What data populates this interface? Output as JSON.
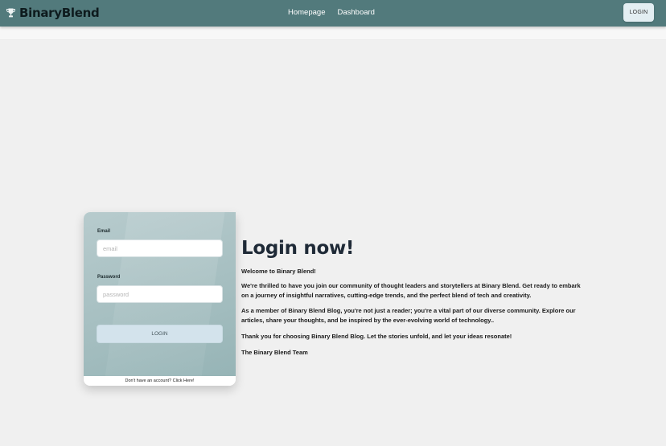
{
  "navbar": {
    "brand": "BinaryBlend",
    "brand_icon": "trophy-icon",
    "links": [
      "Homepage",
      "Dashboard"
    ],
    "login_label": "LOGIN",
    "bg_color": "#527a7c"
  },
  "login_form": {
    "email_label": "Email",
    "email_placeholder": "email",
    "email_value": "",
    "password_label": "Password",
    "password_placeholder": "password",
    "password_value": "",
    "submit_label": "LOGIN",
    "signup_text": "Don't have an account? Click Here!"
  },
  "intro": {
    "title": "Login now!",
    "paragraphs": [
      "Welcome to Binary Blend!",
      "We're thrilled to have you join our community of thought leaders and storytellers at Binary Blend. Get ready to embark on a journey of insightful narratives, cutting-edge trends, and the perfect blend of tech and creativity.",
      "As a member of Binary Blend Blog, you're not just a reader; you're a vital part of our diverse community. Explore our articles, share your thoughts, and be inspired by the ever-evolving world of technology..",
      "Thank you for choosing Binary Blend Blog. Let the stories unfold, and let your ideas resonate!",
      "The Binary Blend Team"
    ]
  }
}
